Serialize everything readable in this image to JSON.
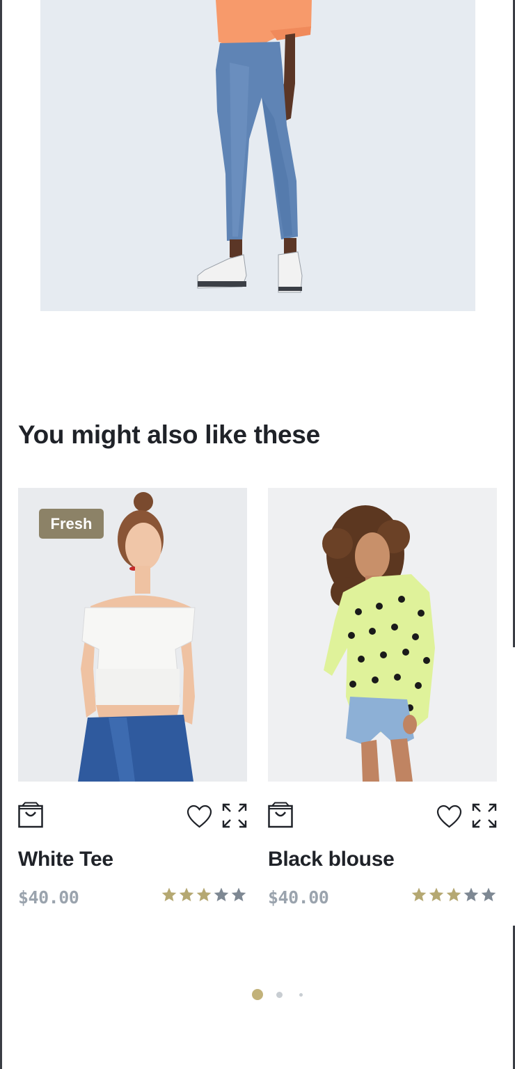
{
  "section": {
    "title": "You might also like these"
  },
  "products": [
    {
      "name": "White Tee",
      "price": "$40.00",
      "badge": "Fresh",
      "rating": 3,
      "rating_max": 5
    },
    {
      "name": "Black blouse",
      "price": "$40.00",
      "badge": "",
      "rating": 3,
      "rating_max": 5
    }
  ],
  "carousel": {
    "pages": 3,
    "active": 1
  },
  "colors": {
    "badge_bg": "#8c8267",
    "star_filled": "#b5a872",
    "star_empty": "#7e8893",
    "dot_active": "#c2b27a",
    "dot_inactive": "#c8cdd2",
    "hero_bg": "#e6ebf1"
  },
  "icons": [
    "shopping-bag-icon",
    "heart-icon",
    "expand-icon",
    "star-icon"
  ]
}
